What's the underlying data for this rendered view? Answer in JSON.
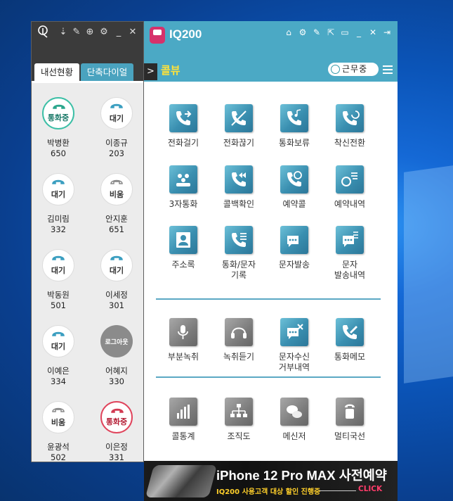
{
  "app": {
    "title": "IQ200"
  },
  "left_panel": {
    "tabs": [
      "내선현황",
      "단축다이얼"
    ],
    "extensions": [
      {
        "status": "통화중",
        "name": "박병환",
        "number": "650",
        "state": "busy-green"
      },
      {
        "status": "대기",
        "name": "이종규",
        "number": "203",
        "state": "idle"
      },
      {
        "status": "대기",
        "name": "김미림",
        "number": "332",
        "state": "idle"
      },
      {
        "status": "비움",
        "name": "안지훈",
        "number": "651",
        "state": "away"
      },
      {
        "status": "대기",
        "name": "박동원",
        "number": "501",
        "state": "idle"
      },
      {
        "status": "대기",
        "name": "이세정",
        "number": "301",
        "state": "idle"
      },
      {
        "status": "대기",
        "name": "이예은",
        "number": "334",
        "state": "idle"
      },
      {
        "status": "로그아웃",
        "name": "어혜지",
        "number": "330",
        "state": "logout"
      },
      {
        "status": "비움",
        "name": "윤광석",
        "number": "502",
        "state": "away"
      },
      {
        "status": "통화중",
        "name": "이은정",
        "number": "331",
        "state": "busy-red"
      }
    ]
  },
  "main_panel": {
    "section_title": "콜뷰",
    "status_pill": "근무중",
    "functions": [
      {
        "label": "전화걸기",
        "icon": "phone-outgoing-icon"
      },
      {
        "label": "전화끊기",
        "icon": "phone-hangup-icon"
      },
      {
        "label": "통화보류",
        "icon": "phone-hold-icon"
      },
      {
        "label": "착신전환",
        "icon": "call-forward-icon"
      },
      {
        "label": "3자통화",
        "icon": "conference-icon"
      },
      {
        "label": "콜백확인",
        "icon": "callback-icon"
      },
      {
        "label": "예약콜",
        "icon": "reserve-call-icon"
      },
      {
        "label": "예약내역",
        "icon": "reserve-list-icon"
      },
      {
        "label": "주소록",
        "icon": "address-book-icon"
      },
      {
        "label": "통화/문자\n기록",
        "icon": "call-log-icon"
      },
      {
        "label": "문자발송",
        "icon": "sms-send-icon"
      },
      {
        "label": "문자\n발송내역",
        "icon": "sms-history-icon"
      },
      {
        "label": "부분녹취",
        "icon": "partial-record-icon"
      },
      {
        "label": "녹취듣기",
        "icon": "listen-record-icon"
      },
      {
        "label": "문자수신\n거부내역",
        "icon": "sms-block-icon"
      },
      {
        "label": "통화메모",
        "icon": "call-memo-icon"
      },
      {
        "label": "콜통계",
        "icon": "call-stats-icon"
      },
      {
        "label": "조직도",
        "icon": "org-chart-icon"
      },
      {
        "label": "메신저",
        "icon": "messenger-icon"
      },
      {
        "label": "멀티국선",
        "icon": "multi-line-icon"
      }
    ]
  },
  "banner": {
    "title": "iPhone 12 Pro MAX 사전예약",
    "subtitle": "IQ200 사용고객 대상 할인 진행중",
    "cta": "CLICK"
  },
  "colors": {
    "accent": "#4ba9c5",
    "brand": "#d6316b",
    "highlight": "#ffe23a"
  }
}
